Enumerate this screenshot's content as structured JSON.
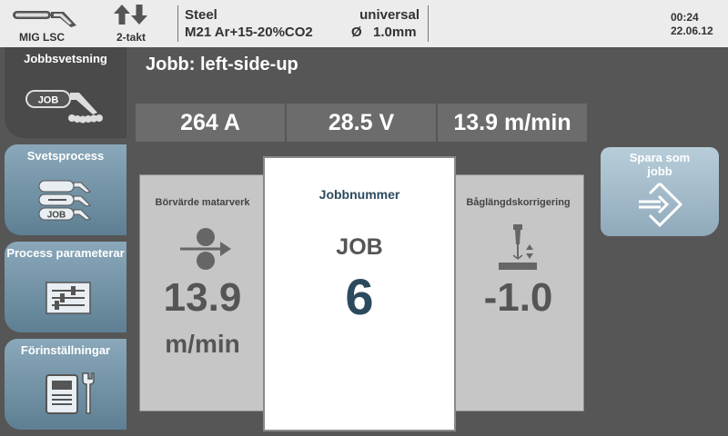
{
  "topbar": {
    "process_label": "MIG LSC",
    "trigger_label": "2-takt",
    "material": "Steel",
    "gas": "M21 Ar+15-20%CO2",
    "mode": "universal",
    "diameter_symbol": "Ø",
    "diameter": "1.0mm",
    "time": "00:24",
    "date": "22.06.12"
  },
  "sidebar": {
    "items": [
      {
        "label": "Jobbsvetsning",
        "icon_badge": "JOB"
      },
      {
        "label": "Svetsprocess",
        "icon_badge": "JOB"
      },
      {
        "label": "Process parameterar"
      },
      {
        "label": "Förinställningar"
      }
    ]
  },
  "job": {
    "title": "Jobb: left-side-up"
  },
  "values": {
    "current": "264 A",
    "voltage": "28.5 V",
    "wire_speed": "13.9 m/min"
  },
  "cards": {
    "feed": {
      "title": "Börvärde matarverk",
      "value": "13.9",
      "unit": "m/min"
    },
    "job": {
      "title": "Jobbnummer",
      "label": "JOB",
      "value": "6"
    },
    "arc": {
      "title": "Båglängdskorrigering",
      "value": "-1.0"
    }
  },
  "save_button": {
    "label": "Spara som jobb"
  },
  "colors": {
    "accent_blue": "#2c4a5e",
    "tab_blue": "#6f8fa3",
    "panel_dark": "#565656",
    "value_box": "#6c6c6c"
  }
}
